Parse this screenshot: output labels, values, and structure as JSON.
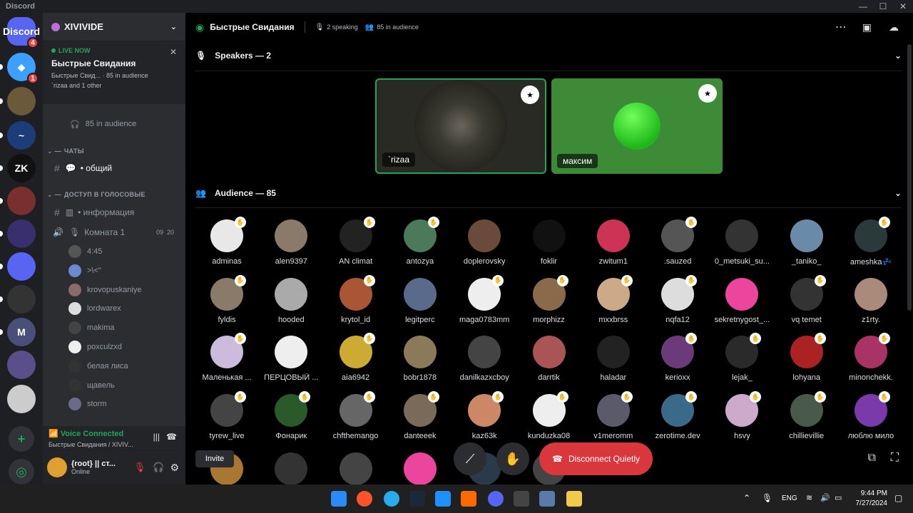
{
  "window": {
    "title": "Discord",
    "controls": [
      "—",
      "☐",
      "✕"
    ]
  },
  "servers": [
    {
      "label": "Discord",
      "color": "#5865f2",
      "badge": "4"
    },
    {
      "label": "◆",
      "color": "#3ba0ff",
      "badge": "1"
    },
    {
      "label": "",
      "color": "#6b5a3a",
      "badge": ""
    },
    {
      "label": "~",
      "color": "#1d3c7a",
      "badge": ""
    },
    {
      "label": "ZK",
      "color": "#111111",
      "badge": ""
    },
    {
      "label": "",
      "color": "#7a2f2f",
      "badge": ""
    },
    {
      "label": "",
      "color": "#3a2f6e",
      "badge": ""
    },
    {
      "label": "",
      "color": "#5865f2",
      "badge": ""
    },
    {
      "label": "",
      "color": "#333333",
      "badge": ""
    },
    {
      "label": "M",
      "color": "#4a4f7a",
      "badge": ""
    },
    {
      "label": "",
      "color": "#5a4f8a",
      "badge": ""
    },
    {
      "label": "",
      "color": "#cccccc",
      "badge": ""
    }
  ],
  "guild": {
    "name": "XIVIVIDE"
  },
  "live": {
    "badge": "LIVE NOW",
    "title": "Быстрые Свидания",
    "sub1": "Быстрые Свид...  ·  85 in audience",
    "sub2": "`rizaa and 1 other"
  },
  "channels": {
    "audience_row": "85 in audience",
    "cat_chats": "ЧАТЫ",
    "general": "• общий",
    "cat_voice": "ДОСТУП В ГОЛОСОВЫЕ",
    "info": "• информация",
    "room1": "Комната 1",
    "room1_time1": "09",
    "room1_time2": "20",
    "members": [
      "4:45",
      ">\\<\"",
      "krovopuskaniye",
      "lordwarex",
      "makima",
      "poxculzxd",
      "белая лиса",
      "щавель",
      "storm"
    ]
  },
  "voice": {
    "status": "Voice Connected",
    "location": "Быстрые Свидания / XIVIV..."
  },
  "user": {
    "name": "{root} || ст...",
    "status": "Online"
  },
  "topbar": {
    "title": "Быстрые Свидания",
    "speaking": "2 speaking",
    "audience": "85 in audience"
  },
  "speakers": {
    "header": "Speakers — 2",
    "list": [
      {
        "name": "`rizaa",
        "bg": "#2a2a24"
      },
      {
        "name": "максим",
        "bg": "#3d8b37"
      }
    ]
  },
  "audience": {
    "header": "Audience — 85",
    "list": [
      {
        "name": "adminas",
        "color": "#e8e8e8"
      },
      {
        "name": "alen9397",
        "color": "#8a7a6a"
      },
      {
        "name": "AN climat",
        "color": "#222222"
      },
      {
        "name": "antozya",
        "color": "#4a7a5a"
      },
      {
        "name": "doplerovsky",
        "color": "#6a4a3a"
      },
      {
        "name": "foklir",
        "color": "#111111"
      },
      {
        "name": "zwitum1",
        "color": "#cc3355"
      },
      {
        "name": ".sauzed",
        "color": "#555555"
      },
      {
        "name": "0_metsuki_su...",
        "color": "#333333"
      },
      {
        "name": "_taniko_",
        "color": "#6a8aaa"
      },
      {
        "name": "ameshka💤",
        "color": "#2a3a3a"
      },
      {
        "name": "fyldis",
        "color": "#8a7a6a"
      },
      {
        "name": "hooded",
        "color": "#aaaaaa"
      },
      {
        "name": "krytol_id",
        "color": "#aa5533"
      },
      {
        "name": "legitperc",
        "color": "#5a6a8a"
      },
      {
        "name": "maga0783mm",
        "color": "#eeeeee"
      },
      {
        "name": "morphizz",
        "color": "#8a6a4a"
      },
      {
        "name": "mxxbrss",
        "color": "#ccaa88"
      },
      {
        "name": "nqfa12",
        "color": "#dddddd"
      },
      {
        "name": "sekretnygost_...",
        "color": "#eb459e"
      },
      {
        "name": "vq temet",
        "color": "#333333"
      },
      {
        "name": "z1rty.",
        "color": "#aa8a7a"
      },
      {
        "name": "Маленькая ...",
        "color": "#ccbbdd"
      },
      {
        "name": "ПЕРЦОВЫЙ ...",
        "color": "#eeeeee"
      },
      {
        "name": "aia6942",
        "color": "#ccaa33"
      },
      {
        "name": "bobr1878",
        "color": "#8a7a5a"
      },
      {
        "name": "danilkazxcboy",
        "color": "#444444"
      },
      {
        "name": "darrtik",
        "color": "#aa5555"
      },
      {
        "name": "haladar",
        "color": "#222222"
      },
      {
        "name": "kerioxx",
        "color": "#6a3a7a"
      },
      {
        "name": "lejak_",
        "color": "#2a2a2a"
      },
      {
        "name": "lohyana",
        "color": "#aa2222"
      },
      {
        "name": "minonchekk.",
        "color": "#aa3366"
      },
      {
        "name": "tyrew_live",
        "color": "#444444"
      },
      {
        "name": "Фонарик",
        "color": "#2a5a2a"
      },
      {
        "name": "chfthemango",
        "color": "#666666"
      },
      {
        "name": "danteeek",
        "color": "#7a6a5a"
      },
      {
        "name": "kaz63k",
        "color": "#cc8866"
      },
      {
        "name": "kunduzka08",
        "color": "#eeeeee"
      },
      {
        "name": "v1meromm",
        "color": "#5a5a6a"
      },
      {
        "name": "zerotime.dev",
        "color": "#3a6a8a"
      },
      {
        "name": "hsvy",
        "color": "#ccaacc"
      },
      {
        "name": "chillievillie",
        "color": "#4a5a4a"
      },
      {
        "name": "люблю мило",
        "color": "#7a3aaa"
      },
      {
        "name": "",
        "color": "#aa7733"
      },
      {
        "name": "",
        "color": "#333333"
      },
      {
        "name": "",
        "color": "#444444"
      },
      {
        "name": "",
        "color": "#eb459e"
      },
      {
        "name": "",
        "color": "#2a3a4a"
      },
      {
        "name": "",
        "color": "#444444"
      }
    ]
  },
  "controls": {
    "invite": "Invite",
    "disconnect": "Disconnect Quietly"
  },
  "taskbar": {
    "lang": "ENG",
    "time": "9:44 PM",
    "date": "7/27/2024"
  },
  "colors": {
    "accent_green": "#23a559",
    "disconnect_red": "#da373c",
    "blurple": "#5865f2"
  }
}
